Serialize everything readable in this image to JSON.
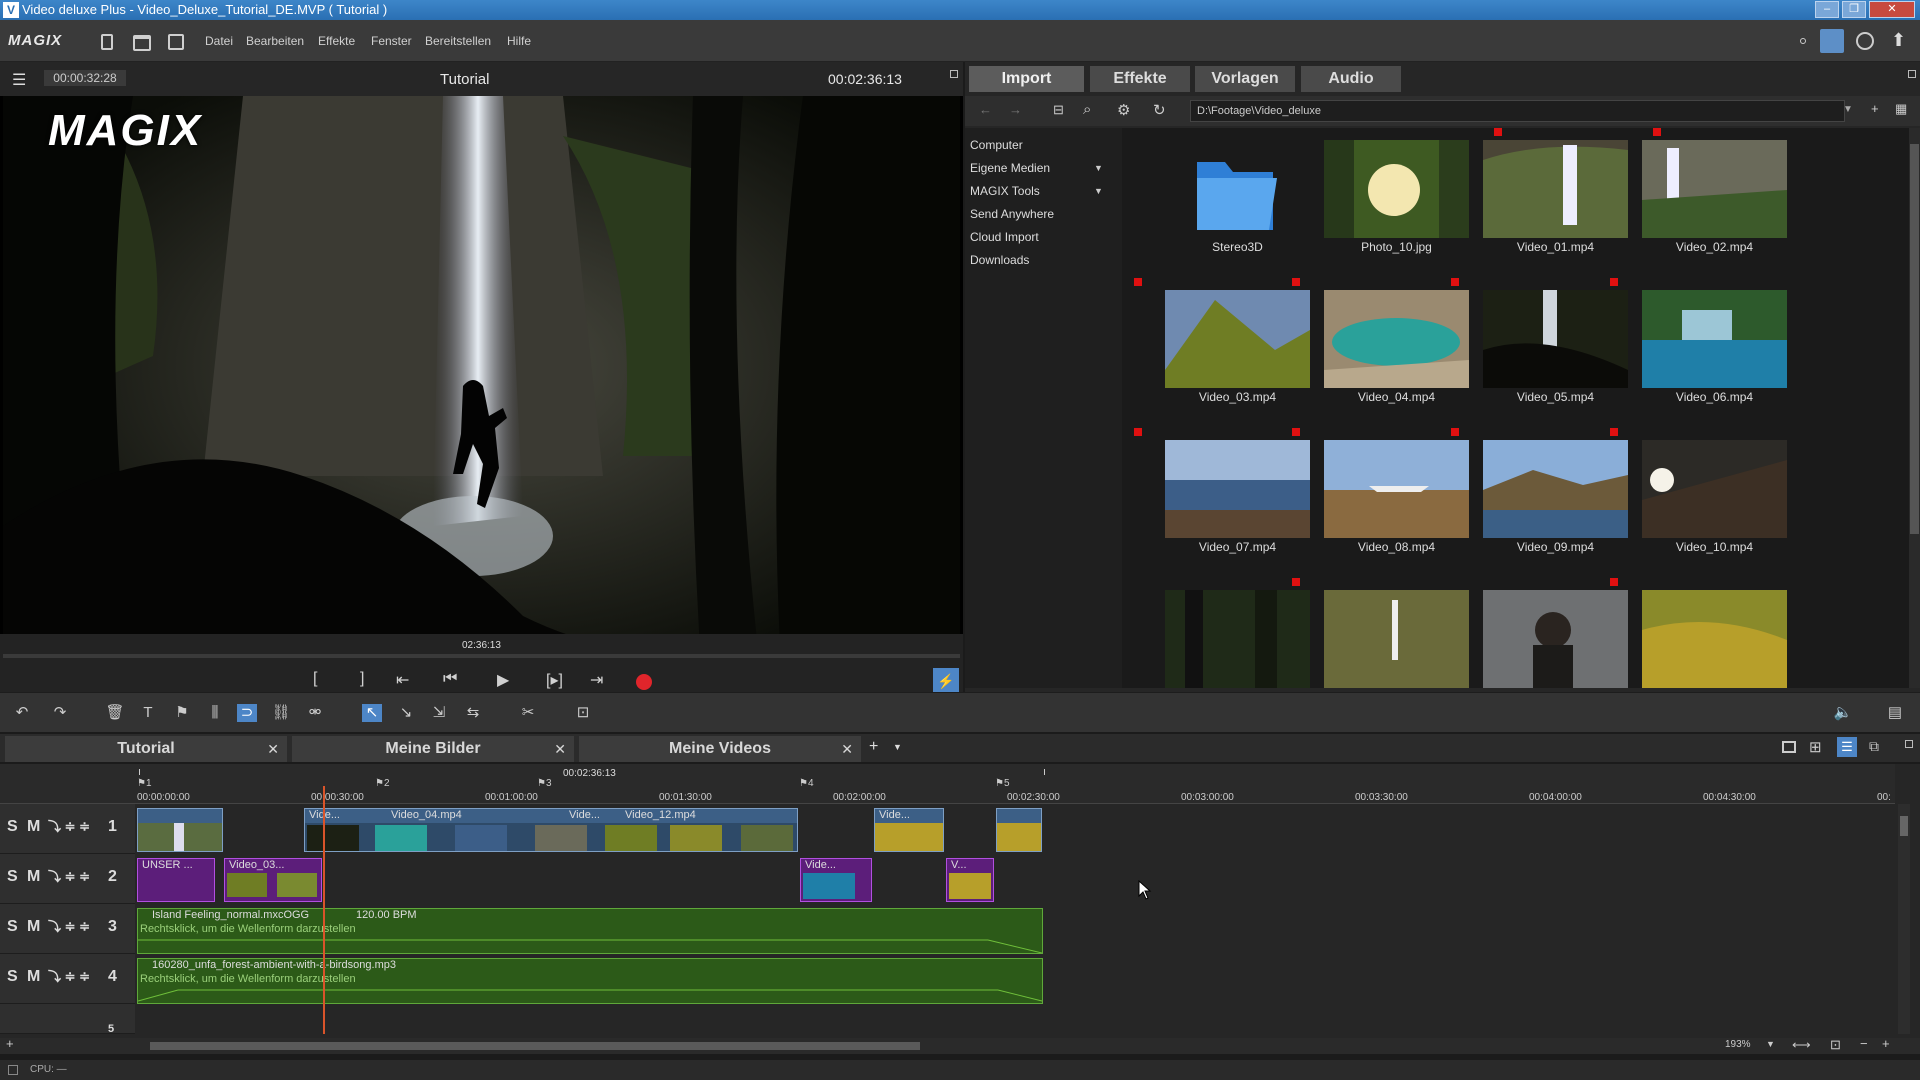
{
  "window": {
    "title": "Video deluxe Plus - Video_Deluxe_Tutorial_DE.MVP ( Tutorial )"
  },
  "menu": {
    "brand": "MAGIX",
    "items": [
      "Datei",
      "Bearbeiten",
      "Effekte",
      "Fenster",
      "Bereitstellen",
      "Hilfe"
    ]
  },
  "preview": {
    "brand_overlay": "MAGIX",
    "timecode_left": "00:00:32:28",
    "title": "Tutorial",
    "timecode_right": "00:02:36:13",
    "scrub_time": "02:36:13"
  },
  "media": {
    "tabs": [
      "Import",
      "Effekte",
      "Vorlagen",
      "Audio"
    ],
    "active_tab": "Import",
    "path": "D:\\Footage\\Video_deluxe",
    "folders": [
      "Computer",
      "Eigene Medien",
      "MAGIX Tools",
      "Send Anywhere",
      "Cloud Import",
      "Downloads"
    ],
    "files": [
      {
        "name": "Stereo3D",
        "kind": "folder"
      },
      {
        "name": "Photo_10.jpg",
        "kind": "image"
      },
      {
        "name": "Video_01.mp4",
        "kind": "video"
      },
      {
        "name": "Video_02.mp4",
        "kind": "video"
      },
      {
        "name": "Video_03.mp4",
        "kind": "video"
      },
      {
        "name": "Video_04.mp4",
        "kind": "video"
      },
      {
        "name": "Video_05.mp4",
        "kind": "video"
      },
      {
        "name": "Video_06.mp4",
        "kind": "video"
      },
      {
        "name": "Video_07.mp4",
        "kind": "video"
      },
      {
        "name": "Video_08.mp4",
        "kind": "video"
      },
      {
        "name": "Video_09.mp4",
        "kind": "video"
      },
      {
        "name": "Video_10.mp4",
        "kind": "video"
      }
    ]
  },
  "projects": {
    "tabs": [
      "Tutorial",
      "Meine Bilder",
      "Meine Videos"
    ]
  },
  "timeline": {
    "header_time": "00:02:36:13",
    "ruler": [
      "00:00:00:00",
      "00:00:30:00",
      "00:01:00:00",
      "00:01:30:00",
      "00:02:00:00",
      "00:02:30:00",
      "00:03:00:00",
      "00:03:30:00",
      "00:04:00:00",
      "00:04:30:00",
      "00:"
    ],
    "markers": [
      "1",
      "2",
      "3",
      "4",
      "5"
    ],
    "track_labels": {
      "s": "S",
      "m": "M"
    },
    "tracks": [
      "1",
      "2",
      "3",
      "4",
      "5"
    ],
    "clips": {
      "t1": [
        "Vide...",
        "Video_04.mp4",
        "Vide...",
        "Video_12.mp4",
        "Vide..."
      ],
      "t2": [
        "UNSER ...",
        "Video_03...",
        "Vide...",
        "V..."
      ],
      "audio1": {
        "name": "Island Feeling_normal.mxcOGG",
        "bpm": "120.00 BPM",
        "hint": "Rechtsklick, um die Wellenform darzustellen"
      },
      "audio2": {
        "name": "160280_unfa_forest-ambient-with-a-birdsong.mp3",
        "hint": "Rechtsklick, um die Wellenform darzustellen"
      }
    },
    "zoom": "193%"
  },
  "status": {
    "cpu": "CPU: —"
  },
  "colors": {
    "accent": "#2a6fb3",
    "record": "#e0252b",
    "video_clip": "#3c5f86",
    "photo_clip": "#5c1e7a",
    "audio_clip": "#2c5a18",
    "playhead": "#d9542a"
  }
}
